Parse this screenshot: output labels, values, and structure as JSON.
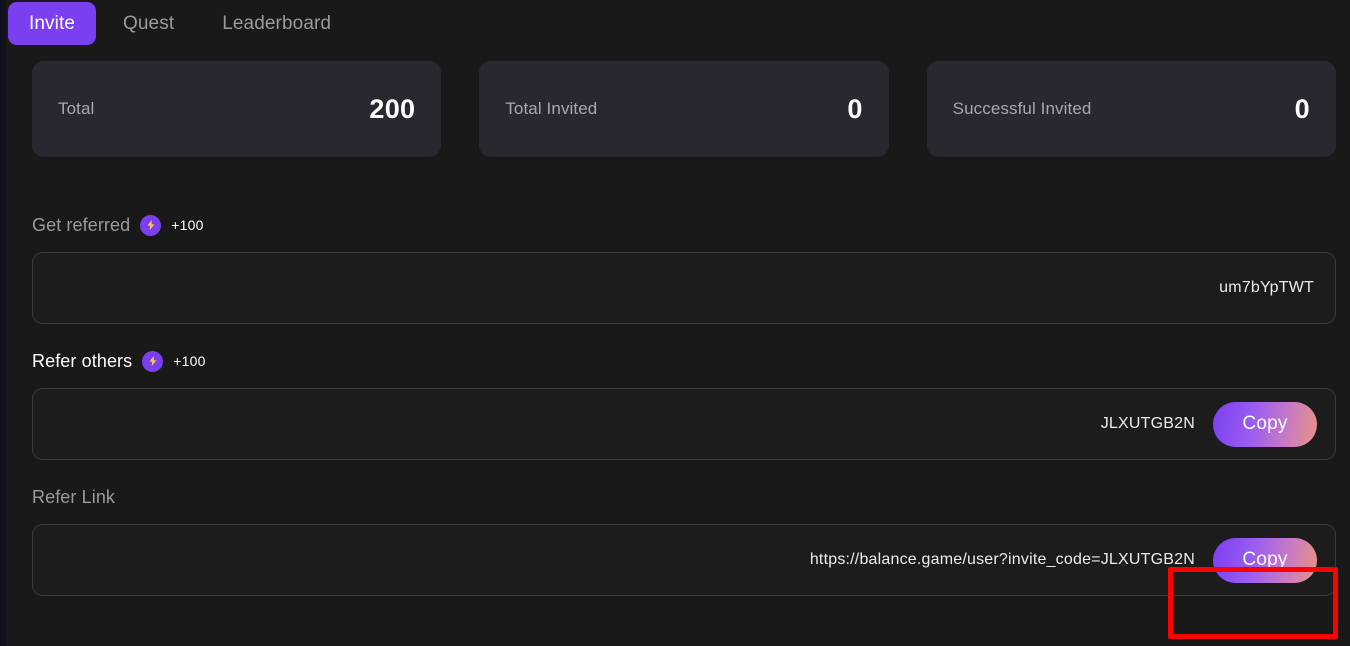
{
  "theme": {
    "page_bg": "#191919",
    "card_bg": "#2b2730",
    "accent_purple": "#7b3ff2",
    "gradient_end": "#e9927f",
    "annotation_red": "#ff0000",
    "bolt_yellow": "#f7c948"
  },
  "tabs": [
    {
      "label": "Invite",
      "active": true
    },
    {
      "label": "Quest",
      "active": false
    },
    {
      "label": "Leaderboard",
      "active": false
    }
  ],
  "stats": [
    {
      "label": "Total",
      "value": "200"
    },
    {
      "label": "Total Invited",
      "value": "0"
    },
    {
      "label": "Successful Invited",
      "value": "0"
    }
  ],
  "sections": {
    "get_referred": {
      "title": "Get referred",
      "reward": "+100",
      "badge_icon": "lightning-bolt-icon",
      "value": "um7bYpTWT",
      "has_copy": false
    },
    "refer_others": {
      "title": "Refer others",
      "reward": "+100",
      "badge_icon": "lightning-bolt-icon",
      "value": "JLXUTGB2N",
      "has_copy": true,
      "copy_label": "Copy"
    },
    "refer_link": {
      "title": "Refer Link",
      "value": "https://balance.game/user?invite_code=JLXUTGB2N",
      "has_copy": true,
      "copy_label": "Copy"
    }
  }
}
